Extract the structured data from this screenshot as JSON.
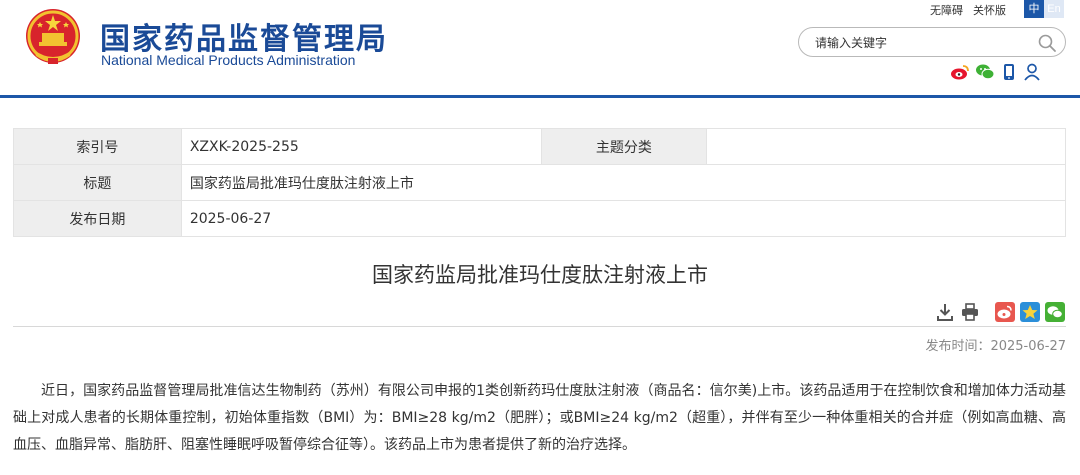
{
  "header": {
    "title_cn": "国家药品监督管理局",
    "title_en": "National Medical Products Administration",
    "top_links": [
      "无障碍",
      "关怀版"
    ],
    "lang_cn": "中",
    "lang_en": "En",
    "search_placeholder": "请输入关键字",
    "social_icons": [
      "weibo-icon",
      "wechat-icon",
      "mobile-icon",
      "user-icon"
    ],
    "colors": {
      "brand_blue": "#1a4a97",
      "rule_blue": "#1c57a8"
    }
  },
  "info": {
    "index_label": "索引号",
    "index_value": "XZXK-2025-255",
    "category_label": "主题分类",
    "category_value": "",
    "title_label": "标题",
    "title_value": "国家药监局批准玛仕度肽注射液上市",
    "date_label": "发布日期",
    "date_value": "2025-06-27"
  },
  "article": {
    "title": "国家药监局批准玛仕度肽注射液上市",
    "pub_time": "发布时间：2025-06-27",
    "tool_icons": [
      "download-icon",
      "print-icon",
      "share-weibo-icon",
      "share-qzone-icon",
      "share-wechat-icon"
    ],
    "body": "近日，国家药品监督管理局批准信达生物制药（苏州）有限公司申报的1类创新药玛仕度肽注射液（商品名：信尔美)上市。该药品适用于在控制饮食和增加体力活动基础上对成人患者的长期体重控制，初始体重指数（BMI）为：BMI≥28 kg/m2（肥胖）；或BMI≥24 kg/m2（超重），并伴有至少一种体重相关的合并症（例如高血糖、高血压、血脂异常、脂肪肝、阻塞性睡眠呼吸暂停综合征等）。该药品上市为患者提供了新的治疗选择。"
  }
}
